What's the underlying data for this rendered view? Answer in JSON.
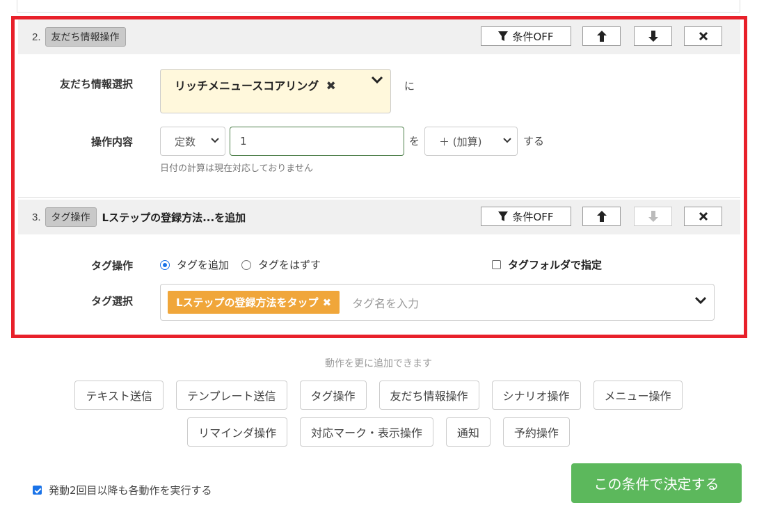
{
  "step2": {
    "number": "2.",
    "type_label": "友だち情報操作",
    "condition_label": "条件OFF",
    "field_label": "友だち情報選択",
    "field_value": "リッチメニュースコアリング",
    "field_suffix": "に",
    "op_label": "操作内容",
    "op_type": "定数",
    "op_value": "1",
    "op_particle": "を",
    "op_method": "＋ (加算)",
    "op_suffix": "する",
    "hint": "日付の計算は現在対応しておりません"
  },
  "step3": {
    "number": "3.",
    "type_label": "タグ操作",
    "title": "Lステップの登録方法...を追加",
    "condition_label": "条件OFF",
    "tag_op_label": "タグ操作",
    "radio_add": "タグを追加",
    "radio_remove": "タグをはずす",
    "folder_label": "タグフォルダで指定",
    "tag_select_label": "タグ選択",
    "tag_value": "Lステップの登録方法をタップ",
    "tag_placeholder": "タグ名を入力"
  },
  "add_actions": {
    "caption": "動作を更に追加できます",
    "row1": [
      "テキスト送信",
      "テンプレート送信",
      "タグ操作",
      "友だち情報操作",
      "シナリオ操作",
      "メニュー操作"
    ],
    "row2": [
      "リマインダ操作",
      "対応マーク・表示操作",
      "通知",
      "予約操作"
    ]
  },
  "footer": {
    "repeat_label": "発動2回目以降も各動作を実行する",
    "repeat_checked": true,
    "decide_label": "この条件で決定する"
  },
  "colors": {
    "highlight_frame": "#e8202a",
    "tag_pill": "#f0a63a",
    "decide_button": "#5cb85c",
    "selected_field": "#fff8dc"
  }
}
